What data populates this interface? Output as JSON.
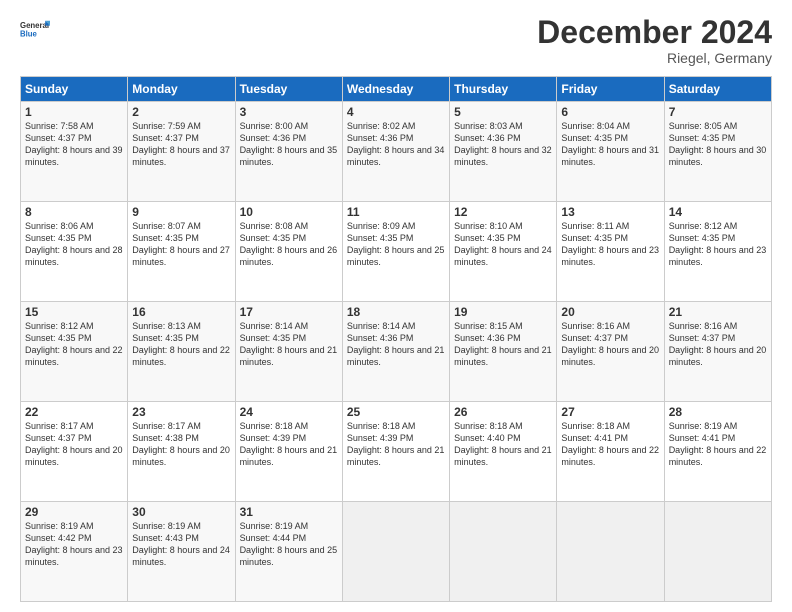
{
  "header": {
    "logo_text_general": "General",
    "logo_text_blue": "Blue",
    "month_title": "December 2024",
    "location": "Riegel, Germany"
  },
  "weekdays": [
    "Sunday",
    "Monday",
    "Tuesday",
    "Wednesday",
    "Thursday",
    "Friday",
    "Saturday"
  ],
  "weeks": [
    [
      {
        "day": "1",
        "sunrise": "7:58 AM",
        "sunset": "4:37 PM",
        "daylight": "8 hours and 39 minutes."
      },
      {
        "day": "2",
        "sunrise": "7:59 AM",
        "sunset": "4:37 PM",
        "daylight": "8 hours and 37 minutes."
      },
      {
        "day": "3",
        "sunrise": "8:00 AM",
        "sunset": "4:36 PM",
        "daylight": "8 hours and 35 minutes."
      },
      {
        "day": "4",
        "sunrise": "8:02 AM",
        "sunset": "4:36 PM",
        "daylight": "8 hours and 34 minutes."
      },
      {
        "day": "5",
        "sunrise": "8:03 AM",
        "sunset": "4:36 PM",
        "daylight": "8 hours and 32 minutes."
      },
      {
        "day": "6",
        "sunrise": "8:04 AM",
        "sunset": "4:35 PM",
        "daylight": "8 hours and 31 minutes."
      },
      {
        "day": "7",
        "sunrise": "8:05 AM",
        "sunset": "4:35 PM",
        "daylight": "8 hours and 30 minutes."
      }
    ],
    [
      {
        "day": "8",
        "sunrise": "8:06 AM",
        "sunset": "4:35 PM",
        "daylight": "8 hours and 28 minutes."
      },
      {
        "day": "9",
        "sunrise": "8:07 AM",
        "sunset": "4:35 PM",
        "daylight": "8 hours and 27 minutes."
      },
      {
        "day": "10",
        "sunrise": "8:08 AM",
        "sunset": "4:35 PM",
        "daylight": "8 hours and 26 minutes."
      },
      {
        "day": "11",
        "sunrise": "8:09 AM",
        "sunset": "4:35 PM",
        "daylight": "8 hours and 25 minutes."
      },
      {
        "day": "12",
        "sunrise": "8:10 AM",
        "sunset": "4:35 PM",
        "daylight": "8 hours and 24 minutes."
      },
      {
        "day": "13",
        "sunrise": "8:11 AM",
        "sunset": "4:35 PM",
        "daylight": "8 hours and 23 minutes."
      },
      {
        "day": "14",
        "sunrise": "8:12 AM",
        "sunset": "4:35 PM",
        "daylight": "8 hours and 23 minutes."
      }
    ],
    [
      {
        "day": "15",
        "sunrise": "8:12 AM",
        "sunset": "4:35 PM",
        "daylight": "8 hours and 22 minutes."
      },
      {
        "day": "16",
        "sunrise": "8:13 AM",
        "sunset": "4:35 PM",
        "daylight": "8 hours and 22 minutes."
      },
      {
        "day": "17",
        "sunrise": "8:14 AM",
        "sunset": "4:35 PM",
        "daylight": "8 hours and 21 minutes."
      },
      {
        "day": "18",
        "sunrise": "8:14 AM",
        "sunset": "4:36 PM",
        "daylight": "8 hours and 21 minutes."
      },
      {
        "day": "19",
        "sunrise": "8:15 AM",
        "sunset": "4:36 PM",
        "daylight": "8 hours and 21 minutes."
      },
      {
        "day": "20",
        "sunrise": "8:16 AM",
        "sunset": "4:37 PM",
        "daylight": "8 hours and 20 minutes."
      },
      {
        "day": "21",
        "sunrise": "8:16 AM",
        "sunset": "4:37 PM",
        "daylight": "8 hours and 20 minutes."
      }
    ],
    [
      {
        "day": "22",
        "sunrise": "8:17 AM",
        "sunset": "4:37 PM",
        "daylight": "8 hours and 20 minutes."
      },
      {
        "day": "23",
        "sunrise": "8:17 AM",
        "sunset": "4:38 PM",
        "daylight": "8 hours and 20 minutes."
      },
      {
        "day": "24",
        "sunrise": "8:18 AM",
        "sunset": "4:39 PM",
        "daylight": "8 hours and 21 minutes."
      },
      {
        "day": "25",
        "sunrise": "8:18 AM",
        "sunset": "4:39 PM",
        "daylight": "8 hours and 21 minutes."
      },
      {
        "day": "26",
        "sunrise": "8:18 AM",
        "sunset": "4:40 PM",
        "daylight": "8 hours and 21 minutes."
      },
      {
        "day": "27",
        "sunrise": "8:18 AM",
        "sunset": "4:41 PM",
        "daylight": "8 hours and 22 minutes."
      },
      {
        "day": "28",
        "sunrise": "8:19 AM",
        "sunset": "4:41 PM",
        "daylight": "8 hours and 22 minutes."
      }
    ],
    [
      {
        "day": "29",
        "sunrise": "8:19 AM",
        "sunset": "4:42 PM",
        "daylight": "8 hours and 23 minutes."
      },
      {
        "day": "30",
        "sunrise": "8:19 AM",
        "sunset": "4:43 PM",
        "daylight": "8 hours and 24 minutes."
      },
      {
        "day": "31",
        "sunrise": "8:19 AM",
        "sunset": "4:44 PM",
        "daylight": "8 hours and 25 minutes."
      },
      null,
      null,
      null,
      null
    ]
  ],
  "labels": {
    "sunrise": "Sunrise:",
    "sunset": "Sunset:",
    "daylight": "Daylight:"
  }
}
